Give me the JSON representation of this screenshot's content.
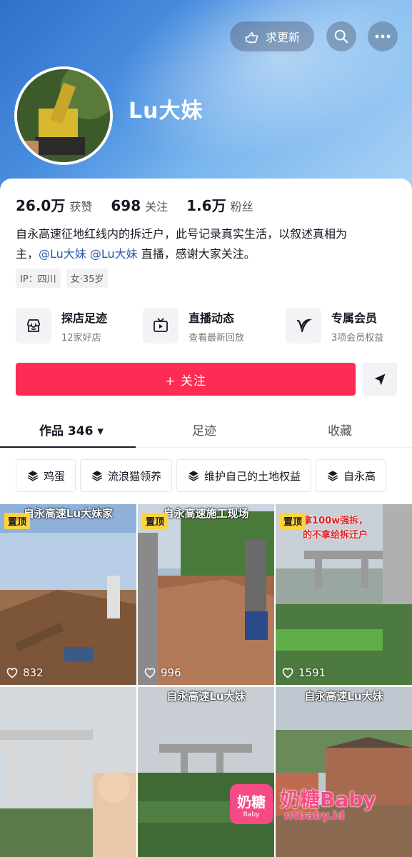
{
  "header": {
    "update_label": "求更新",
    "nickname": "Lu大妹"
  },
  "stats": [
    {
      "num": "26.0万",
      "label": "获赞"
    },
    {
      "num": "698",
      "label": "关注"
    },
    {
      "num": "1.6万",
      "label": "粉丝"
    }
  ],
  "bio": {
    "line1": "自永高速征地红线内的拆迁户，此号记录真实生活，以叙述真相为",
    "line2_prefix": "主，",
    "mention1": "@Lu大妹",
    "mention2": "@Lu大妹",
    "line2_suffix": " 直播，感谢大家关注。"
  },
  "tags": [
    "IP：四川",
    "女·35岁"
  ],
  "features": [
    {
      "title": "探店足迹",
      "sub": "12家好店",
      "icon": "store-icon"
    },
    {
      "title": "直播动态",
      "sub": "查看最新回放",
      "icon": "tv-icon"
    },
    {
      "title": "专属会员",
      "sub": "3项会员权益",
      "icon": "v-icon"
    }
  ],
  "follow_label": "+ 关注",
  "tabs": [
    {
      "label": "作品 346 ▾"
    },
    {
      "label": "足迹"
    },
    {
      "label": "收藏"
    }
  ],
  "collections": [
    "鸡蛋",
    "流浪猫领养",
    "维护自己的土地权益",
    "自永高"
  ],
  "videos": [
    {
      "caption": "自永高速Lu大妹家",
      "pinned": "置顶",
      "likes": "832"
    },
    {
      "caption": "自永高速施工现场",
      "pinned": "置顶",
      "likes": "996"
    },
    {
      "caption": "",
      "pinned": "置顶",
      "likes": "1591",
      "overlay1": "拿100w强拆，",
      "overlay2": "的不拿给拆迁户"
    },
    {
      "caption": "",
      "likes": ""
    },
    {
      "caption": "自永高速Lu大妹",
      "likes": ""
    },
    {
      "caption": "自永高速Lu大妹",
      "likes": ""
    }
  ],
  "watermark": {
    "logo_top": "奶糖",
    "logo_bottom": "Baby",
    "title": "奶糖Baby",
    "url": "ntbaby.id"
  },
  "colors": {
    "follow": "#fe2c55",
    "pin": "#fdd33a",
    "mention": "#2b5aa8",
    "watermark": "#f64a85"
  }
}
